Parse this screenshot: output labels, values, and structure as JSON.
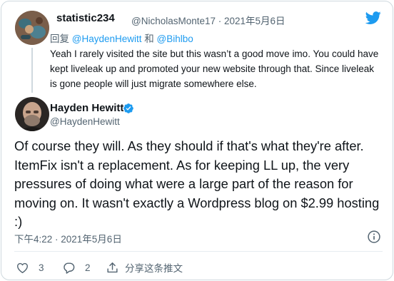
{
  "reply": {
    "name": "statistic234",
    "handle_date": "@NicholasMonte17 · 2021年5月6日",
    "reply_prefix": "回复",
    "reply_user1": "@HaydenHewitt",
    "reply_and": "和",
    "reply_user2": "@Bihlbo",
    "text": "Yeah I rarely visited the site but this wasn’t a good move imo. You could have kept liveleak up and promoted your new website through that. Since liveleak is gone people will just migrate somewhere else."
  },
  "main": {
    "name": "Hayden Hewitt",
    "handle": "@HaydenHewitt",
    "text": "Of course they will. As they should if that's what they're after. ItemFix isn't a replacement. As for keeping LL up, the very pressures of doing what were a large part of the reason for moving on. It wasn't exactly a Wordpress blog on $2.99 hosting :)",
    "timestamp": "下午4:22 · 2021年5月6日"
  },
  "actions": {
    "like_count": "3",
    "reply_count": "2",
    "share_label": "分享这条推文"
  },
  "colors": {
    "twitter_blue": "#1d9bf0",
    "secondary_text": "#536471",
    "border": "#cfd9de"
  },
  "icons": [
    "twitter-logo-icon",
    "verified-badge-icon",
    "info-icon",
    "heart-icon",
    "reply-bubble-icon",
    "share-icon"
  ]
}
